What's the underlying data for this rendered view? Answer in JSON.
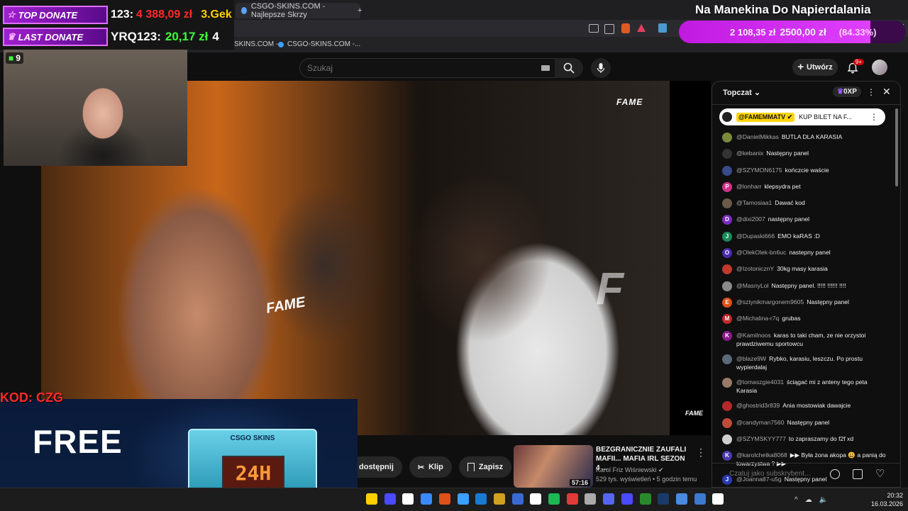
{
  "browser": {
    "tab_title": "CSGO-SKINS.COM - Najlepsze Skrzy",
    "new_tab": "+",
    "bookmarks": [
      "SKINS.COM -...",
      "CSGO-SKINS.COM -..."
    ]
  },
  "youtube": {
    "search_placeholder": "Szukaj",
    "create_label": "Utwórz",
    "notif_count": "9+"
  },
  "video": {
    "logo": "FAME",
    "bg_logo": "F",
    "mic_logo": "FAME"
  },
  "overlay": {
    "top_donate_label": "TOP DONATE",
    "top_donate_value_prefix": "123:",
    "top_donate_amount": "4 388,09 zł",
    "top_donate_extra": "3.Gek",
    "last_donate_label": "LAST DONATE",
    "last_donate_value": "YRQ123:",
    "last_donate_amount": "20,17 zł",
    "last_donate_extra": "4",
    "title": "Na Manekina Do Napierdalania",
    "goal_current": "2 108,35 zł",
    "goal_target": "2500,00 zł",
    "goal_percent": "(84.33%)",
    "goal_fraction": 0.8433,
    "viewer_count": "9",
    "promo_code": "KOD: CZG",
    "promo_free": "FREE",
    "promo_case_label": "CSGO SKINS",
    "promo_case_digits": "24H"
  },
  "actions": {
    "available": "dostępnij",
    "clip": "Klip",
    "save": "Zapisz",
    "more": "..."
  },
  "recommendation": {
    "title": "BEZGRANICZNIE ZAUFALI MAFII... MAFIA IRL SEZON 4 ...",
    "channel": "Karol Friz Wiśniewski ✔",
    "meta": "529 tys. wyświetleń • 5 godzin temu",
    "duration": "57:16"
  },
  "chat": {
    "title": "Topczat",
    "oxp": "0XP",
    "pinned_author": "@FAMEMMATV ✔",
    "pinned_text": "KUP BILET NA F...",
    "input_placeholder": "Czatuj jako subskrybent...",
    "messages": [
      {
        "author": "@DanielMikkas",
        "text": "BUTLA DLA KARASIA",
        "initial": "",
        "color": "#7a8a3a"
      },
      {
        "author": "@kebanix",
        "text": "Następny panel",
        "initial": "",
        "color": "#333333"
      },
      {
        "author": "@SZYMON6175",
        "text": "kończcie waście",
        "initial": "",
        "color": "#3a4a8a"
      },
      {
        "author": "@lonharr",
        "text": "klepsydra pet",
        "initial": "P",
        "color": "#d0308a"
      },
      {
        "author": "@Tamosiaa1",
        "text": "Dawać kod",
        "initial": "",
        "color": "#6a5a4a"
      },
      {
        "author": "@dixi2007",
        "text": "następny panel",
        "initial": "D",
        "color": "#7a2ac0"
      },
      {
        "author": "@Dupaski666",
        "text": "EMO kaRAS :D",
        "initial": "J",
        "color": "#1a8a5a"
      },
      {
        "author": "@OlekOlek-bn6uc",
        "text": "nastepny panel",
        "initial": "O",
        "color": "#4a2ab0"
      },
      {
        "author": "@IzotonicznY",
        "text": "30kg masy karasia",
        "initial": "",
        "color": "#c03a2a"
      },
      {
        "author": "@MasnyLol",
        "text": "Następny panel. !!!!! !!!!!! !!!!",
        "initial": "",
        "color": "#8a8a8a"
      },
      {
        "author": "@sztynikmargonem9605",
        "text": "Następny panel",
        "initial": "E",
        "color": "#e0501a"
      },
      {
        "author": "@Michalina-r7q",
        "text": "grubas",
        "initial": "M",
        "color": "#c02a2a"
      },
      {
        "author": "@Kamilnoos",
        "text": "karas to taki cham, ze nie orzystoi prawdziwemu sportowcu",
        "initial": "K",
        "color": "#8a1a8a"
      },
      {
        "author": "@blaze9W",
        "text": "Rybko, karasiu, leszczu. Po prostu wypierdalaj",
        "initial": "",
        "color": "#5a6a7a"
      },
      {
        "author": "@tomaszgie4031",
        "text": "ściągać mi z anteny tego peta Karasia",
        "initial": "",
        "color": "#9a7a6a"
      },
      {
        "author": "@ghostrid3r839",
        "text": "Ania mostowiak dawajcie",
        "initial": "",
        "color": "#b02a2a"
      },
      {
        "author": "@candyman7560",
        "text": "Następny panel",
        "initial": "",
        "color": "#c04a3a"
      },
      {
        "author": "@SZYMSKYY777",
        "text": "to zapraszamy do f2f xd",
        "initial": "",
        "color": "#cfcfcf"
      },
      {
        "author": "@karolchetka8068",
        "text": "▶▶ Była żona akopa 😃 a panią do towarzystwa ? ▶▶",
        "initial": "K",
        "color": "#4a3ab0"
      },
      {
        "author": "@Joanna87-u5g",
        "text": "Następny panel",
        "initial": "J",
        "color": "#2a3ab0"
      }
    ]
  },
  "taskbar": {
    "time": "20:32",
    "date": "16.03.2026",
    "chevron": "^"
  },
  "colors": {
    "accent_purple": "#c01adf",
    "youtube_red": "#cc0000",
    "donate_green": "#3aff3a",
    "donate_red": "#ff2a2a"
  }
}
